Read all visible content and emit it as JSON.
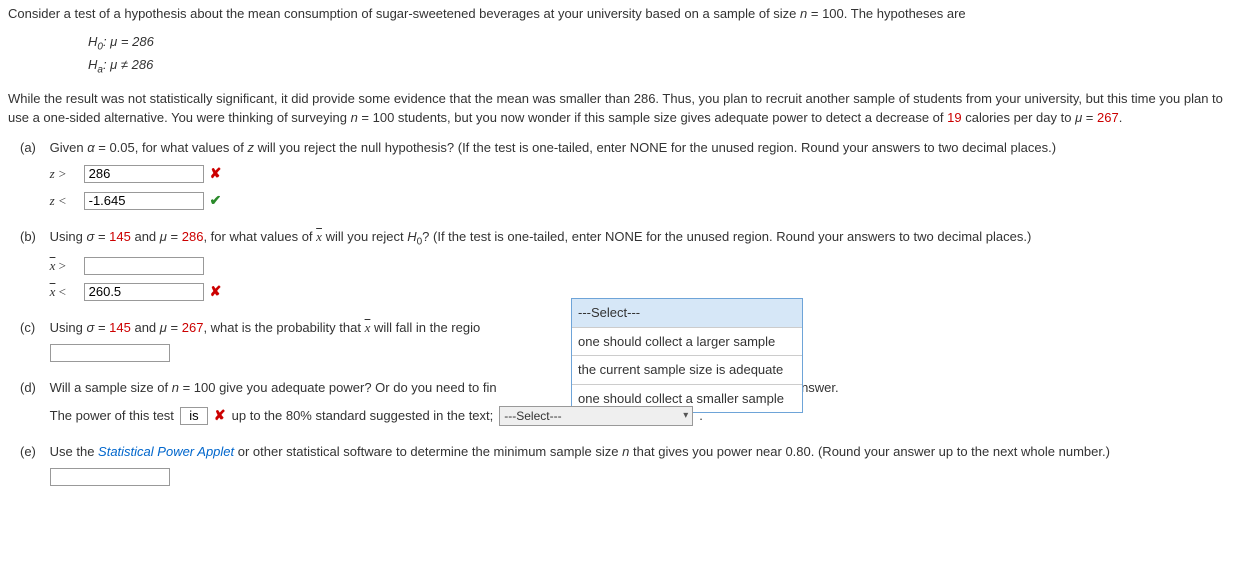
{
  "intro": "Consider a test of a hypothesis about the mean consumption of sugar-sweetened beverages at your university based on a sample of size ",
  "intro_n": "n",
  "intro_n_val": " = 100. The hypotheses are",
  "hyp": {
    "h0_lhs": "H",
    "h0_sub": "0",
    "h0_rhs": ": μ = 286",
    "ha_lhs": "H",
    "ha_sub": "a",
    "ha_rhs": ": μ ≠ 286"
  },
  "para2_a": "While the result was not statistically significant, it did provide some evidence that the mean was smaller than 286. Thus, you plan to recruit another sample of students from your university, but this time you plan to use a one-sided alternative. You were thinking of surveying ",
  "para2_n": "n",
  "para2_b": " = 100 students, but you now wonder if this sample size gives adequate power to detect a decrease of ",
  "decrease_val": "19",
  "para2_c": " calories per day to ",
  "mu_eq": "μ",
  "mu_val": "267",
  "period": ".",
  "a": {
    "label": "(a)",
    "text_a": "Given ",
    "alpha": "α",
    "text_b": " = 0.05, for what values of ",
    "z": "z",
    "text_c": " will you reject the null hypothesis? (If the test is one-tailed, enter NONE for the unused region. Round your answers to two decimal places.)",
    "row1_prefix": "z  >",
    "row1_val": "286",
    "row2_prefix": "z  <",
    "row2_val": "-1.645"
  },
  "b": {
    "label": "(b)",
    "text_a": "Using ",
    "sigma": "σ",
    "sigma_val": "145",
    "and": " and ",
    "mu": "μ",
    "mu_val": "286",
    "text_b": ", for what values of ",
    "xbar": "x",
    "text_c": " will you reject ",
    "h0": "H",
    "h0_sub": "0",
    "text_d": "? (If the test is one-tailed, enter NONE for the unused region. Round your answers to two decimal places.)",
    "row1_prefix_x": "x",
    "row1_op": " >",
    "row1_val": "",
    "row2_prefix_x": "x",
    "row2_op": " <",
    "row2_val": "260.5"
  },
  "c": {
    "label": "(c)",
    "text_a": "Using ",
    "sigma": "σ",
    "sigma_val": "145",
    "and": " and ",
    "mu": "μ",
    "mu_val": "267",
    "text_b": ", what is the probability that ",
    "xbar": "x",
    "text_c": " will fall in the regio",
    "input_val": ""
  },
  "dropdown": {
    "opt0": "---Select---",
    "opt1": "one should collect a larger sample",
    "opt2": "the current sample size is adequate",
    "opt3": "one should collect a smaller sample"
  },
  "d": {
    "label": "(d)",
    "text_a": "Will a sample size of ",
    "n": "n",
    "text_b": " = 100 give you adequate power? Or do you need to fin",
    "text_tail": "plain your answer.",
    "line2_a": "The power of this test ",
    "is_val": "is",
    "line2_b": "  up to the 80% standard suggested in the text; ",
    "select_label": "---Select---",
    "line2_c": " ."
  },
  "e": {
    "label": "(e)",
    "text_a": "Use the ",
    "link": "Statistical Power Applet",
    "text_b": " or other statistical software to determine the minimum sample size ",
    "n": "n",
    "text_c": " that gives you power near 0.80. (Round your answer up to the next whole number.)",
    "input_val": ""
  }
}
